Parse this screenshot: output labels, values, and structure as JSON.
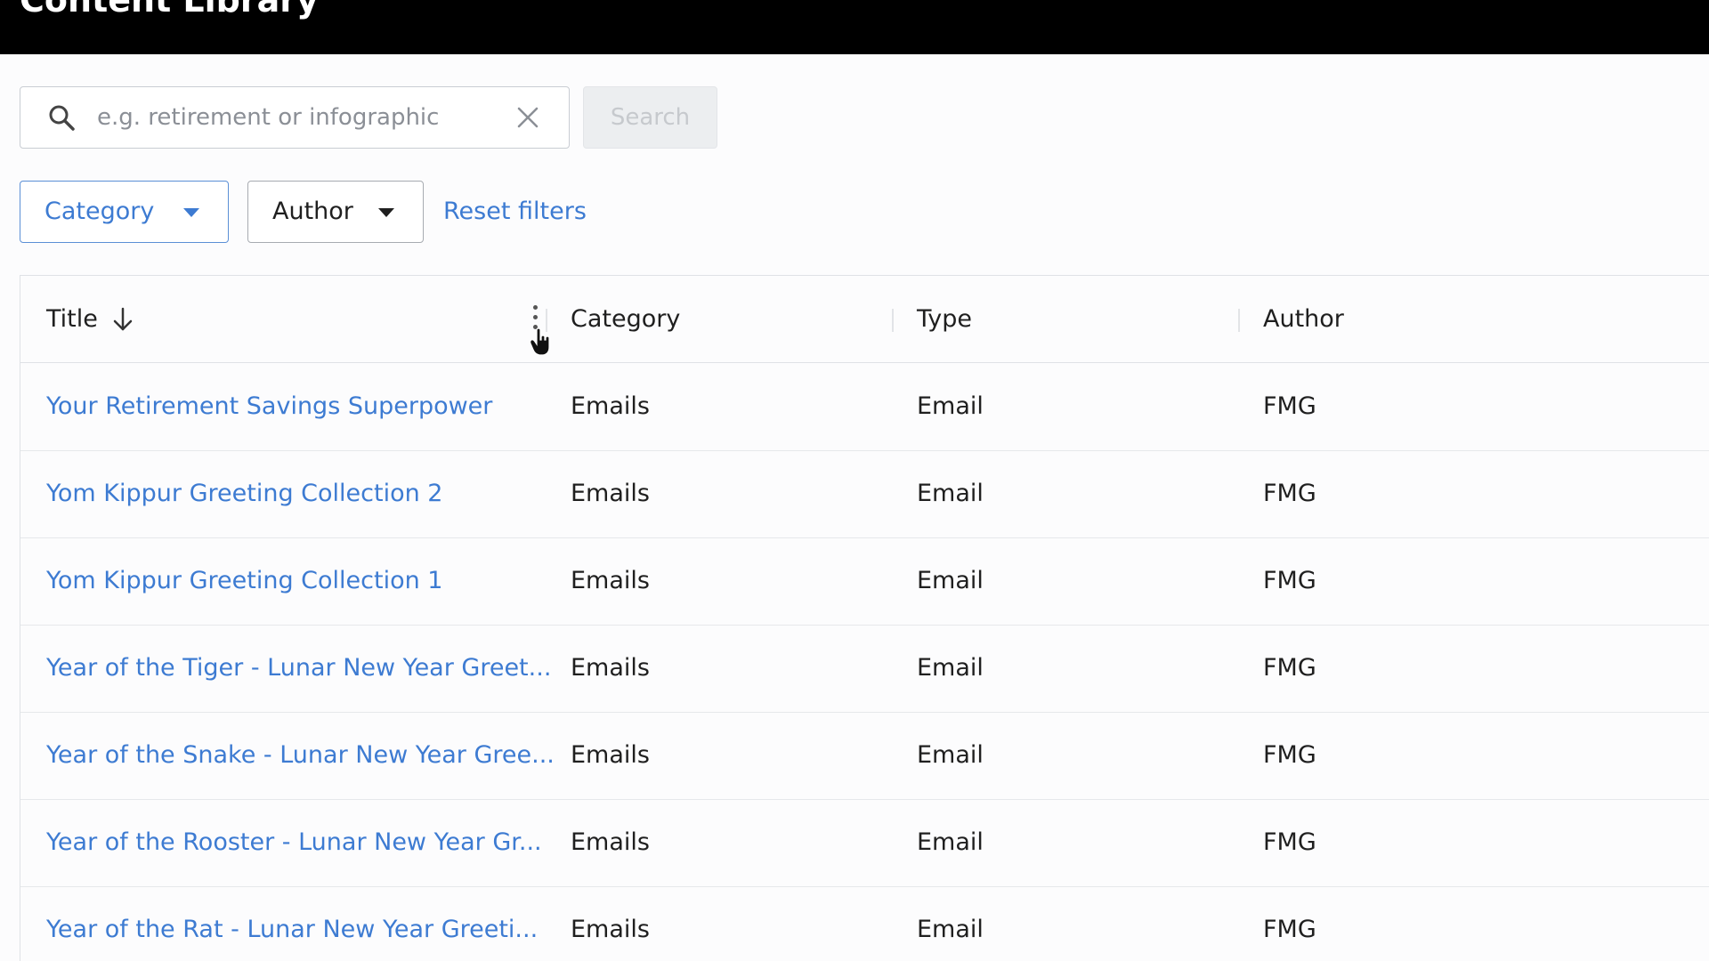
{
  "header": {
    "title": "Content Library"
  },
  "search": {
    "placeholder": "e.g. retirement or infographic",
    "value": "",
    "button_label": "Search"
  },
  "filters": {
    "category_label": "Category",
    "author_label": "Author",
    "reset_label": "Reset filters"
  },
  "table": {
    "columns": [
      "Title",
      "Category",
      "Type",
      "Author"
    ],
    "sort": {
      "column": "Title",
      "direction": "descending"
    },
    "rows": [
      {
        "title": "Your Retirement Savings Superpower",
        "category": "Emails",
        "type": "Email",
        "author": "FMG"
      },
      {
        "title": "Yom Kippur Greeting Collection 2",
        "category": "Emails",
        "type": "Email",
        "author": "FMG"
      },
      {
        "title": "Yom Kippur Greeting Collection 1",
        "category": "Emails",
        "type": "Email",
        "author": "FMG"
      },
      {
        "title": "Year of the Tiger - Lunar New Year Greet...",
        "category": "Emails",
        "type": "Email",
        "author": "FMG"
      },
      {
        "title": "Year of the Snake - Lunar New Year Gree...",
        "category": "Emails",
        "type": "Email",
        "author": "FMG"
      },
      {
        "title": "Year of the Rooster - Lunar New Year Gr...",
        "category": "Emails",
        "type": "Email",
        "author": "FMG"
      },
      {
        "title": "Year of the Rat - Lunar New Year Greeti...",
        "category": "Emails",
        "type": "Email",
        "author": "FMG"
      }
    ]
  },
  "icons": {
    "search": "search-icon",
    "clear": "close-icon",
    "caret": "caret-down-icon",
    "sort": "arrow-down-icon",
    "column_menu": "more-vertical-icon",
    "cursor": "hand-pointer-icon"
  },
  "colors": {
    "link": "#3d7bd2",
    "text": "#1f1f1f",
    "topbar": "#000000",
    "border": "#dfe2e6",
    "disabled_button_bg": "#eceef0",
    "disabled_button_text": "#c6c9cd"
  }
}
